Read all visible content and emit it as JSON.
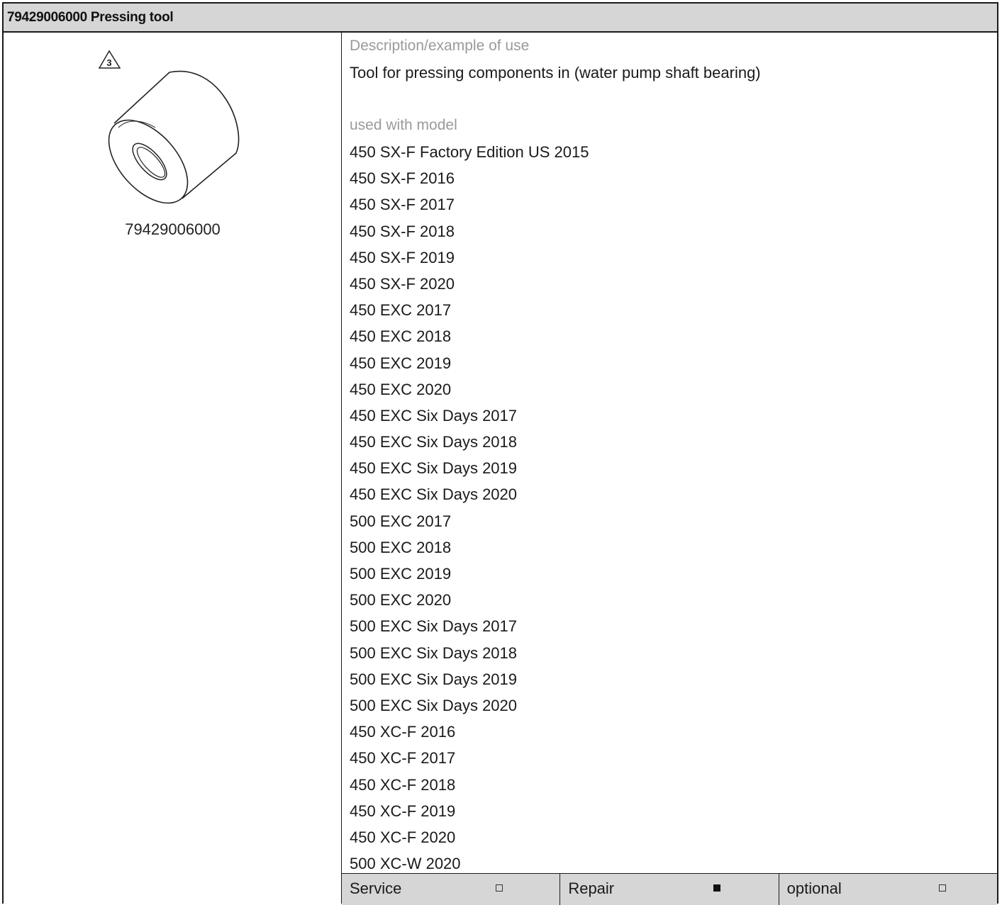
{
  "header": {
    "title": "79429006000 Pressing tool"
  },
  "image": {
    "badge": "3",
    "part_number": "79429006000",
    "icon": "pressing-tool-cylinder-icon"
  },
  "description": {
    "label": "Description/example of use",
    "text": "Tool for pressing components in (water pump shaft bearing)"
  },
  "models": {
    "label": "used with model",
    "items": [
      "450 SX-F Factory Edition US 2015",
      "450 SX-F 2016",
      "450 SX-F 2017",
      "450 SX-F 2018",
      "450 SX-F 2019",
      "450 SX-F 2020",
      "450 EXC 2017",
      "450 EXC 2018",
      "450 EXC 2019",
      "450 EXC 2020",
      "450 EXC Six Days 2017",
      "450 EXC Six Days 2018",
      "450 EXC Six Days 2019",
      "450 EXC Six Days 2020",
      "500 EXC 2017",
      "500 EXC 2018",
      "500 EXC 2019",
      "500 EXC 2020",
      "500 EXC Six Days 2017",
      "500 EXC Six Days 2018",
      "500 EXC Six Days 2019",
      "500 EXC Six Days 2020",
      "450 XC-F 2016",
      "450 XC-F 2017",
      "450 XC-F 2018",
      "450 XC-F 2019",
      "450 XC-F 2020",
      "500 XC-W 2020"
    ]
  },
  "footer": {
    "service": {
      "label": "Service",
      "checked": false
    },
    "repair": {
      "label": "Repair",
      "checked": true
    },
    "optional": {
      "label": "optional",
      "checked": false
    }
  }
}
